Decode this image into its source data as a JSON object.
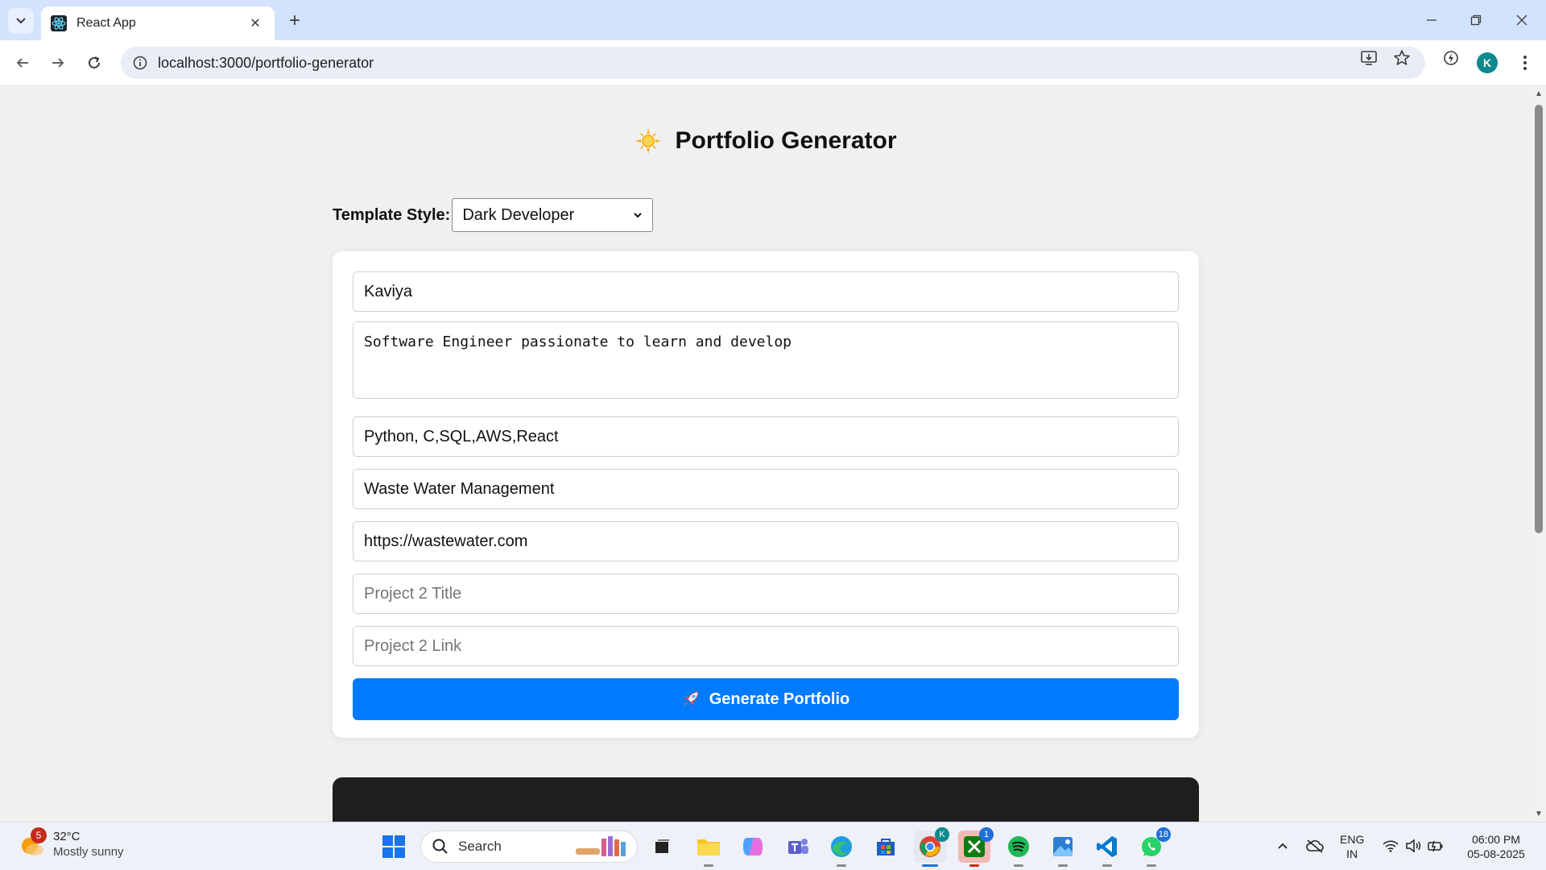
{
  "browser": {
    "tab_title": "React App",
    "url": "localhost:3000/portfolio-generator",
    "profile_initial": "K"
  },
  "page": {
    "title": "Portfolio Generator",
    "template_style_label": "Template Style:",
    "template_style_value": "Dark Developer",
    "form": {
      "name": "Kaviya",
      "bio": "Software Engineer passionate to learn and develop",
      "skills": "Python, C,SQL,AWS,React",
      "project1_title": "Waste Water Management",
      "project1_link": "https://wastewater.com",
      "project2_title_placeholder": "Project 2 Title",
      "project2_link_placeholder": "Project 2 Link"
    },
    "generate_button": "Generate Portfolio"
  },
  "taskbar": {
    "weather_temp": "32°C",
    "weather_condition": "Mostly sunny",
    "weather_badge": "5",
    "search_label": "Search",
    "chrome_badge": "K",
    "xbox_badge": "1",
    "whatsapp_badge": "18",
    "lang_line1": "ENG",
    "lang_line2": "IN",
    "time": "06:00 PM",
    "date": "05-08-2025"
  },
  "colors": {
    "primary_button": "#007bff",
    "preview_bg": "#1e1e1e",
    "page_bg": "#f0f0f0"
  }
}
